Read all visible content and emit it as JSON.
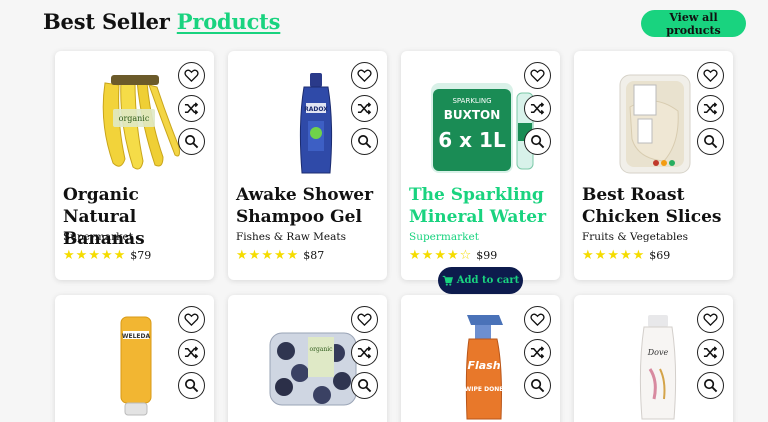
{
  "header": {
    "title_main": "Best Seller",
    "title_accent": "Products",
    "view_all_label": "View all products"
  },
  "colors": {
    "accent": "#19d37f",
    "navy": "#0d1b4d",
    "star": "#f5dc00"
  },
  "products": [
    {
      "name": "Organic Natural Bananas",
      "category": "Supermarket",
      "price": "$79",
      "rating": 5,
      "image": "bananas"
    },
    {
      "name": "Awake Shower Shampoo Gel",
      "category": "Fishes & Raw Meats",
      "price": "$87",
      "rating": 5,
      "image": "shower-gel"
    },
    {
      "name": "The Sparkling Mineral Water",
      "category": "Supermarket",
      "price": "$99",
      "rating": 4,
      "image": "water-pack"
    },
    {
      "name": "Best Roast Chicken Slices",
      "category": "Fruits & Vegetables",
      "price": "$69",
      "rating": 5,
      "image": "chicken-pack"
    },
    {
      "name": "",
      "category": "",
      "price": "",
      "rating": 0,
      "image": "weleda-tube"
    },
    {
      "name": "",
      "category": "",
      "price": "",
      "rating": 0,
      "image": "blueberries"
    },
    {
      "name": "",
      "category": "",
      "price": "",
      "rating": 0,
      "image": "flash-spray"
    },
    {
      "name": "",
      "category": "",
      "price": "",
      "rating": 0,
      "image": "dove-bottle"
    }
  ],
  "card_actions": [
    "heart-icon",
    "shuffle-icon",
    "search-icon"
  ],
  "add_to_cart_label": "Add to cart",
  "images": {
    "bananas": "organic",
    "shower_gel": "RADOX",
    "water_top": "SPARKLING",
    "water_brand": "BUXTON",
    "water_size": "6 x 1L",
    "weleda": "WELEDA",
    "blueberries": "organic",
    "flash": "Flash",
    "flash_sub": "WIPE DONE",
    "dove": "Dove"
  }
}
